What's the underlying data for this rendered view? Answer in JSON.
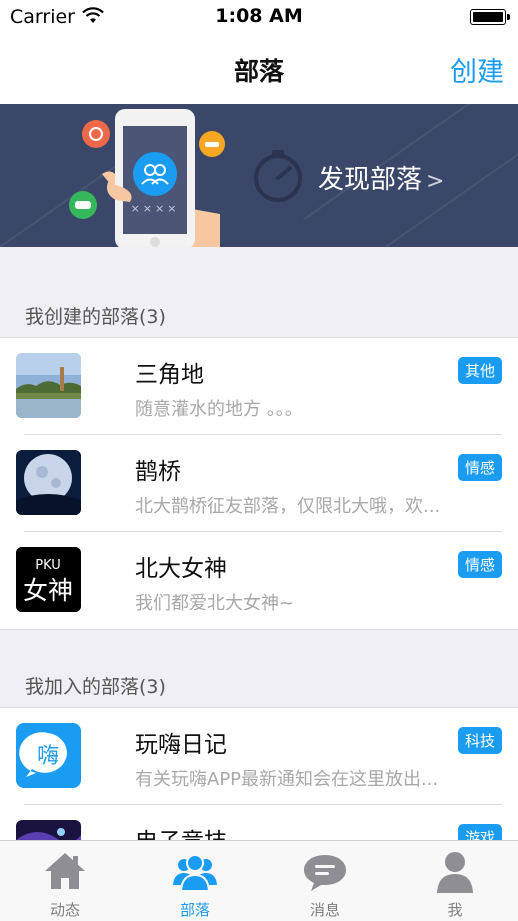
{
  "status": {
    "carrier": "Carrier",
    "time": "1:08 AM"
  },
  "nav": {
    "title": "部落",
    "create_label": "创建"
  },
  "banner": {
    "discover_label": "发现部落",
    "arrow": ">",
    "phone_code": "××××"
  },
  "created_section": {
    "header": "我创建的部落(3)",
    "items": [
      {
        "name": "三角地",
        "desc": "随意灌水的地方 。。。",
        "tag": "其他",
        "thumb": "campus-photo"
      },
      {
        "name": "鹊桥",
        "desc": "北大鹊桥征友部落，仅限北大哦，欢...",
        "tag": "情感",
        "thumb": "moon-photo"
      },
      {
        "name": "北大女神",
        "desc": "我们都爱北大女神~",
        "tag": "情感",
        "thumb": "pku-logo",
        "thumb_text_top": "PKU",
        "thumb_text_main": "女神"
      }
    ]
  },
  "joined_section": {
    "header": "我加入的部落(3)",
    "items": [
      {
        "name": "玩嗨日记",
        "desc": "有关玩嗨APP最新通知会在这里放出...",
        "tag": "科技",
        "thumb": "wanhai-logo",
        "thumb_text": "嗨"
      },
      {
        "name": "电子竞技",
        "desc": "",
        "tag": "游戏",
        "thumb": "esports-photo"
      }
    ]
  },
  "tabs": [
    {
      "label": "动态",
      "icon": "home-icon",
      "active": false
    },
    {
      "label": "部落",
      "icon": "group-icon",
      "active": true
    },
    {
      "label": "消息",
      "icon": "chat-icon",
      "active": false
    },
    {
      "label": "我",
      "icon": "person-icon",
      "active": false
    }
  ],
  "colors": {
    "accent": "#1a9cf2",
    "banner": "#3b4768",
    "background": "#efeff4"
  }
}
